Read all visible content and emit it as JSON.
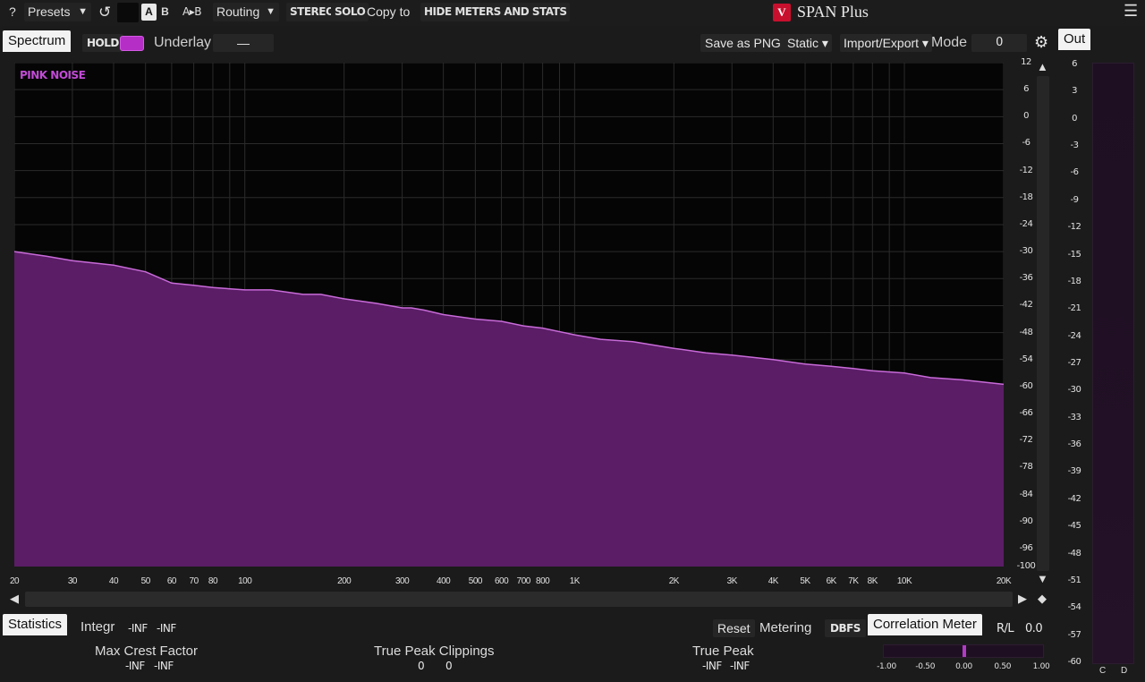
{
  "toolbar": {
    "help": "?",
    "presets": "Presets",
    "presets_arrow": "▼",
    "undo_icon": "↺",
    "a": "A",
    "b": "B",
    "a_to_b": "A▸B",
    "routing": "Routing",
    "routing_arrow": "▼",
    "stereo": "STEREO",
    "solo": "SOLO",
    "copy_to": "Copy to",
    "hide_meters": "HIDE METERS AND STATS",
    "app_title": "SPAN Plus",
    "menu_icon": "☰"
  },
  "spectrum_bar": {
    "tab": "Spectrum",
    "hold": "HOLD",
    "hold_color": "#b52fc7",
    "underlay_label": "Underlay",
    "underlay_value": "—",
    "save_png": "Save as PNG",
    "static": "Static ▾",
    "import_export": "Import/Export ▾",
    "mode_label": "Mode",
    "mode_value": "0",
    "settings_icon": "⚙",
    "out_tab": "Out"
  },
  "spectrum": {
    "trace_label": "PINK NOISE",
    "fill_color": "#5a1d66",
    "line_color": "#c86ad8"
  },
  "chart_data": {
    "type": "area",
    "series": [
      {
        "name": "PINK NOISE",
        "x": [
          20,
          25,
          30,
          40,
          50,
          60,
          70,
          80,
          100,
          120,
          150,
          170,
          200,
          250,
          300,
          320,
          350,
          400,
          500,
          600,
          700,
          800,
          1000,
          1200,
          1500,
          2000,
          2500,
          3000,
          4000,
          5000,
          6000,
          7000,
          8000,
          10000,
          12000,
          15000,
          20000
        ],
        "values": [
          -30,
          -31,
          -32,
          -33,
          -34.5,
          -37,
          -37.5,
          -38,
          -38.5,
          -38.5,
          -39.5,
          -39.5,
          -40.5,
          -41.5,
          -42.5,
          -42.5,
          -43,
          -44,
          -45,
          -45.5,
          -46.5,
          -47,
          -48.5,
          -49.5,
          -50,
          -51.5,
          -52.5,
          -53,
          -54,
          -55,
          -55.5,
          -56,
          -56.5,
          -57,
          -58,
          -58.5,
          -59.5
        ]
      }
    ],
    "y_ticks": [
      "12",
      "6",
      "0",
      "-6",
      "-12",
      "-18",
      "-24",
      "-30",
      "-36",
      "-42",
      "-48",
      "-54",
      "-60",
      "-66",
      "-72",
      "-78",
      "-84",
      "-90",
      "-96",
      "-100"
    ],
    "x_ticks": [
      "20",
      "30",
      "40",
      "50",
      "60",
      "70",
      "80",
      "100",
      "200",
      "300",
      "400",
      "500",
      "600",
      "700",
      "800",
      "1K",
      "2K",
      "3K",
      "4K",
      "5K",
      "6K",
      "7K",
      "8K",
      "10K",
      "20K"
    ],
    "xlim": [
      20,
      20000
    ],
    "ylim": [
      -100,
      12
    ],
    "x_scale": "log",
    "grid": true
  },
  "out_meter": {
    "ticks": [
      "6",
      "3",
      "0",
      "-3",
      "-6",
      "-9",
      "-12",
      "-15",
      "-18",
      "-21",
      "-24",
      "-27",
      "-30",
      "-33",
      "-36",
      "-39",
      "-42",
      "-45",
      "-48",
      "-51",
      "-54",
      "-57",
      "-60"
    ],
    "channel_c": "C",
    "channel_d": "D"
  },
  "scroll": {
    "left_icon": "◀",
    "right_icon": "▶",
    "up_icon": "▲",
    "down_icon": "▼",
    "diamond_icon": "◆"
  },
  "statistics": {
    "tab": "Statistics",
    "integr_label": "Integr",
    "integr_l": "-INF",
    "integr_r": "-INF",
    "reset": "Reset",
    "metering_label": "Metering",
    "metering_value": "DBFS",
    "max_crest_label": "Max Crest Factor",
    "max_crest_l": "-INF",
    "max_crest_r": "-INF",
    "true_peak_clip_label": "True Peak Clippings",
    "true_peak_clip_l": "0",
    "true_peak_clip_r": "0",
    "true_peak_label": "True Peak",
    "true_peak_l": "-INF",
    "true_peak_r": "-INF"
  },
  "correlation": {
    "tab": "Correlation Meter",
    "rl_label": "R/L",
    "rl_value": "0.0",
    "ticks": [
      "-1.00",
      "-0.50",
      "0.00",
      "0.50",
      "1.00"
    ],
    "value": 0.0
  }
}
